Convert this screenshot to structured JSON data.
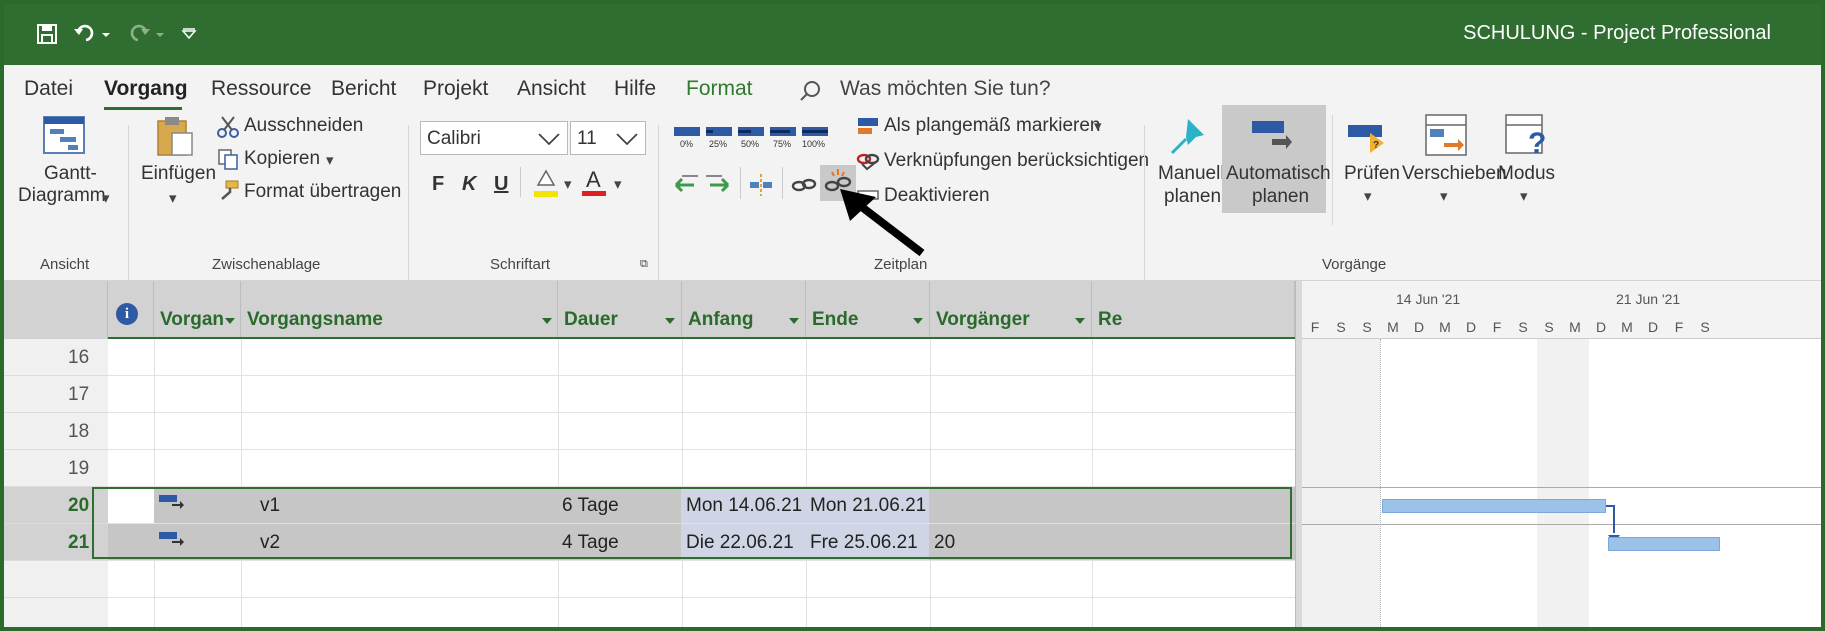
{
  "window": {
    "title": "SCHULUNG  -  Project Professional",
    "theme_color": "#2f6e30"
  },
  "qat": {
    "save_icon": "save-icon",
    "undo_icon": "undo-icon",
    "redo_icon": "redo-icon",
    "customize_icon": "customize-qat-icon"
  },
  "menu": {
    "tabs": [
      {
        "label": "Datei"
      },
      {
        "label": "Vorgang"
      },
      {
        "label": "Ressource"
      },
      {
        "label": "Bericht"
      },
      {
        "label": "Projekt"
      },
      {
        "label": "Ansicht"
      },
      {
        "label": "Hilfe"
      },
      {
        "label": "Format"
      }
    ],
    "active_tab": "Vorgang",
    "search_placeholder": "Was möchten Sie tun?"
  },
  "ribbon": {
    "ansicht": {
      "button": "Gantt-",
      "button2": "Diagramm",
      "group": "Ansicht"
    },
    "zwischenablage": {
      "paste": "Einfügen",
      "cut": "Ausschneiden",
      "copy": "Kopieren",
      "format_painter": "Format übertragen",
      "group": "Zwischenablage"
    },
    "schriftart": {
      "font": "Calibri",
      "size": "11",
      "bold": "F",
      "italic": "K",
      "underline": "U",
      "group": "Schriftart"
    },
    "zeitplan": {
      "progress": [
        "0%",
        "25%",
        "50%",
        "75%",
        "100%"
      ],
      "mark_on_track": "Als plangemäß markieren",
      "respect_links": "Verknüpfungen berücksichtigen",
      "deactivate": "Deaktivieren",
      "group": "Zeitplan"
    },
    "vorgaenge": {
      "manual1": "Manuell",
      "manual2": "planen",
      "auto1": "Automatisch",
      "auto2": "planen",
      "inspect": "Prüfen",
      "move": "Verschieben",
      "mode": "Modus",
      "group": "Vorgänge"
    }
  },
  "table": {
    "columns": {
      "info": "i",
      "mode": "Vorgan",
      "name": "Vorgangsname",
      "duration": "Dauer",
      "start": "Anfang",
      "end": "Ende",
      "predecessors": "Vorgänger",
      "resources": "Re"
    },
    "rows": [
      {
        "id": "16",
        "name": "",
        "duration": "",
        "start": "",
        "end": "",
        "pred": ""
      },
      {
        "id": "17",
        "name": "",
        "duration": "",
        "start": "",
        "end": "",
        "pred": ""
      },
      {
        "id": "18",
        "name": "",
        "duration": "",
        "start": "",
        "end": "",
        "pred": ""
      },
      {
        "id": "19",
        "name": "",
        "duration": "",
        "start": "",
        "end": "",
        "pred": ""
      },
      {
        "id": "20",
        "name": "v1",
        "duration": "6 Tage",
        "start": "Mon 14.06.21",
        "end": "Mon 21.06.21",
        "pred": ""
      },
      {
        "id": "21",
        "name": "v2",
        "duration": "4 Tage",
        "start": "Die 22.06.21",
        "end": "Fre 25.06.21",
        "pred": "20"
      }
    ]
  },
  "gantt": {
    "week1": "14 Jun '21",
    "week2": "21 Jun '21",
    "days": [
      "F",
      "S",
      "S",
      "M",
      "D",
      "M",
      "D",
      "F",
      "S",
      "S",
      "M",
      "D",
      "M",
      "D",
      "F",
      "S"
    ],
    "bar_color": "#9cc2ea"
  }
}
